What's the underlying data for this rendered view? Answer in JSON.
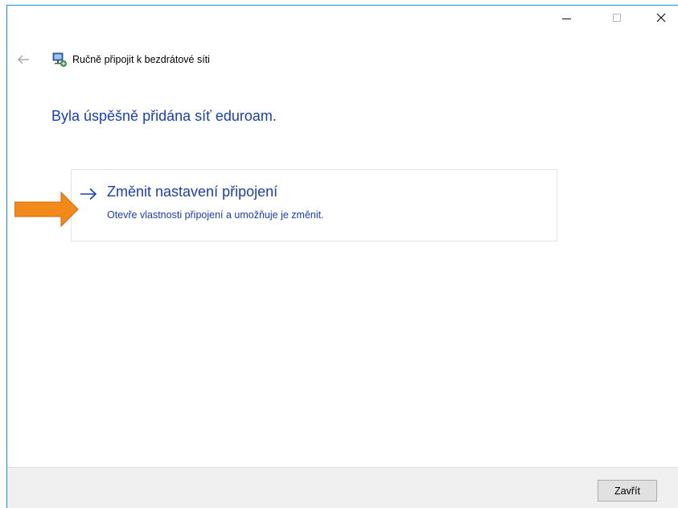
{
  "window": {
    "title": "Ručně připojit k bezdrátové síti",
    "controls": {
      "minimize_icon": "minimize-icon",
      "maximize_icon": "maximize-icon",
      "close_icon": "close-icon"
    }
  },
  "message": {
    "success": "Byla úspěšně přidána síť eduroam."
  },
  "option": {
    "title": "Změnit nastavení připojení",
    "description": "Otevře vlastnosti připojení a umožňuje je změnit.",
    "icon": "arrow-right-icon"
  },
  "footer": {
    "close_label": "Zavřít"
  },
  "colors": {
    "link_blue": "#1a3fb0",
    "accent_border": "#1b8fd8",
    "callout_orange": "#f28a1b",
    "footer_bg": "#f0f0f0"
  }
}
